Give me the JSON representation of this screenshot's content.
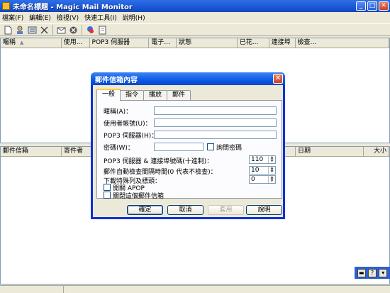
{
  "window": {
    "title": "未命名標題 - Magic Mail Monitor",
    "buttons": [
      "_",
      "□",
      "✕"
    ]
  },
  "menu": [
    "檔案(F)",
    "編輯(E)",
    "檢視(V)",
    "快速工具(I)",
    "說明(H)"
  ],
  "toolbar": {
    "icons": [
      "new-file-icon",
      "add-account-icon",
      "properties-icon",
      "delete-icon",
      "check-mail-icon",
      "stop-icon",
      "user-icon",
      "notepad-icon"
    ]
  },
  "top_list": {
    "columns": [
      "暱稱",
      "使用...",
      "POP3 伺服器",
      "電子...",
      "狀態",
      "已花...",
      "連接埠",
      "檢查..."
    ]
  },
  "bottom_list": {
    "columns": [
      "郵件信箱",
      "寄件者",
      "日期",
      "大小"
    ]
  },
  "dialog": {
    "title": "郵件信箱內容",
    "tabs": [
      "一般",
      "指令",
      "播放",
      "郵件"
    ],
    "fields": {
      "nickname_label": "暱稱(A)：",
      "username_label": "使用者帳號(U)：",
      "pop3_label": "POP3 伺服器(H)：",
      "password_label": "密碼(W)：",
      "ask_password": "詢問密碼",
      "port_label": "POP3 伺服器 & 連接埠號碼(十進制)：",
      "port_value": "110",
      "interval_label": "郵件自動檢查間隔時間(0 代表不檢查)：",
      "interval_value": "10",
      "headers_label": "下載特殊列及標頭：",
      "headers_value": "0",
      "apop": "開關 APOP",
      "disable": "關閉這個郵件信箱"
    },
    "buttons": {
      "ok": "確定",
      "cancel": "取消",
      "apply": "套用",
      "help": "說明"
    }
  },
  "tray": [
    "▬",
    "?",
    "▾"
  ],
  "colors": {
    "titlebar": "#1a57d6",
    "dialog_border": "#0831d9",
    "background": "#ece9d8"
  }
}
